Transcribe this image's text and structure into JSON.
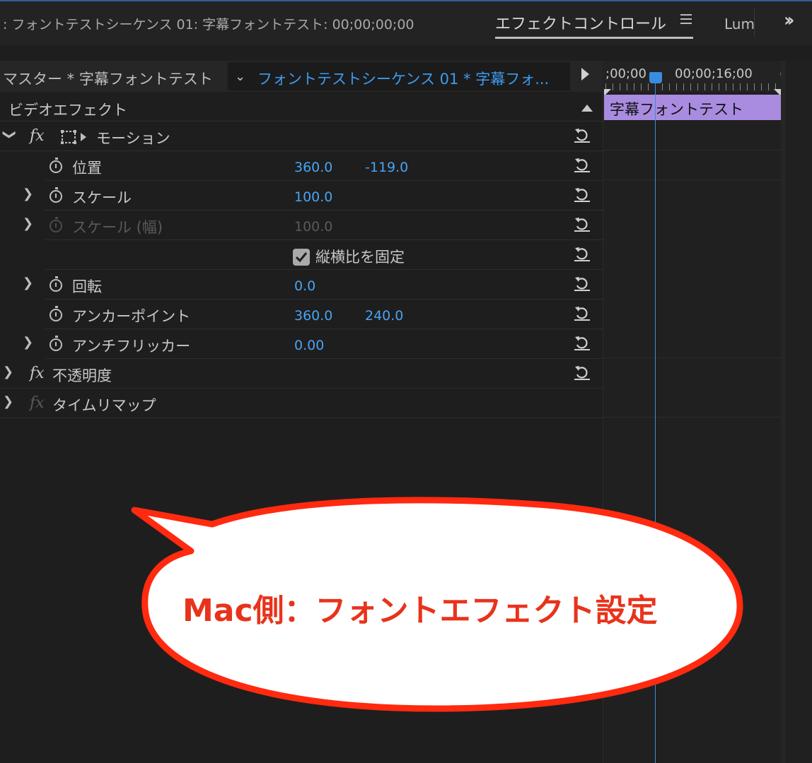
{
  "tabs": {
    "sequence_title": ": フォントテストシーケンス 01: 字幕フォントテスト: 00;00;00;00",
    "effect_controls": "エフェクトコントロール",
    "lumetri": "Lum"
  },
  "header": {
    "master": "マスター * 字幕フォントテスト",
    "sequence_clip": "フォントテストシーケンス 01 * 字幕フォ..."
  },
  "video_effects": "ビデオエフェクト",
  "effects": {
    "motion": "モーション",
    "opacity": "不透明度",
    "time_remap": "タイムリマップ",
    "fx_symbol": "fx"
  },
  "motion_params": {
    "position": {
      "label": "位置",
      "x": "360.0",
      "y": "-119.0"
    },
    "scale": {
      "label": "スケール",
      "value": "100.0"
    },
    "scale_width": {
      "label": "スケール (幅)",
      "value": "100.0"
    },
    "uniform_scale": {
      "label": "縦横比を固定",
      "checked": true
    },
    "rotation": {
      "label": "回転",
      "value": "0.0"
    },
    "anchor_point": {
      "label": "アンカーポイント",
      "x": "360.0",
      "y": "240.0"
    },
    "anti_flicker": {
      "label": "アンチフリッカー",
      "value": "0.00"
    }
  },
  "timeline": {
    "tc_start": ";00;00",
    "tc_mid": "00;00;16;00",
    "tc_end": "(",
    "clip_name": "字幕フォントテスト"
  },
  "callout": {
    "text": "Mac側：フォントエフェクト設定",
    "text_color": "#e8331c",
    "border_color": "#ff2a0f"
  },
  "colors": {
    "value_blue": "#48a3f2",
    "link_blue": "#3e9bef",
    "clip_purple": "#a98ce0",
    "playhead": "#3a8ce0"
  }
}
